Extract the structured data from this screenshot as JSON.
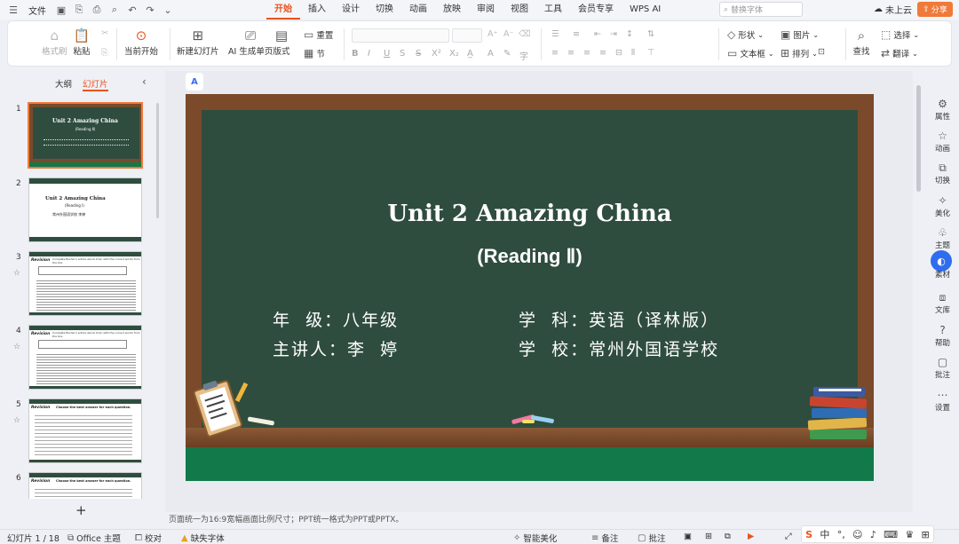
{
  "menubar": {
    "file_label": "文件",
    "tabs": [
      "开始",
      "插入",
      "设计",
      "切换",
      "动画",
      "放映",
      "审阅",
      "视图",
      "工具",
      "会员专享",
      "WPS AI"
    ],
    "search_placeholder": "替换字体",
    "cloud_label": "未上云",
    "share_label": "分享"
  },
  "ribbon": {
    "format_painter": "格式刷",
    "paste": "粘贴",
    "play_from_current": "当前开始",
    "new_slide": "新建幻灯片",
    "ai_single": "AI 生成单页",
    "layout": "版式",
    "reset": "重置",
    "section": "节",
    "shape": "形状",
    "picture": "图片",
    "textbox": "文本框",
    "arrange": "排列",
    "find": "查找",
    "select": "选择",
    "translate": "翻译"
  },
  "left_panel": {
    "tab_outline": "大纲",
    "tab_slides": "幻灯片",
    "slide_numbers": [
      "1",
      "2",
      "3",
      "4",
      "5",
      "6"
    ],
    "thumb1_title": "Unit 2 Amazing China",
    "thumb1_sub": "(Reading Ⅱ)",
    "thumb2_title": "Unit 2 Amazing China",
    "thumb2_sub": "(Reading Ⅰ)",
    "thumb2_school": "常州外国语学校  李婷",
    "thumb3_label": "Revision",
    "thumb3_text": "Complete Border's article about Xi'an with the correct words from the box.",
    "thumb4_label": "Revision",
    "thumb4_text": "Complete Border's article about Xi'an with the correct words from the box.",
    "thumb5_label": "Revision",
    "thumb5_text": "Choose the best answer for each question.",
    "thumb6_label": "Revision",
    "thumb6_text": "Choose the best answer for each question."
  },
  "slide": {
    "title": "Unit 2 Amazing China",
    "subtitle": "(Reading Ⅱ)",
    "info_grade": "年  级：八年级",
    "info_subject": "学  科：英语（译林版）",
    "info_teacher": "主讲人：李  婷",
    "info_school": "学  校：常州外国语学校"
  },
  "right_bar": [
    "属性",
    "动画",
    "切换",
    "美化",
    "主题",
    "素材",
    "文库",
    "帮助",
    "批注",
    "设置"
  ],
  "notes_text": "页面统一为16:9宽幅画面比例尺寸；PPT统一格式为PPT或PPTX。",
  "statusbar": {
    "slide_count": "幻灯片 1 / 18",
    "theme": "Office 主题",
    "proofread": "校对",
    "missing_font": "缺失字体",
    "smart_beautify": "智能美化",
    "notes": "备注",
    "comments": "批注"
  },
  "ime": {
    "lang": "中"
  }
}
